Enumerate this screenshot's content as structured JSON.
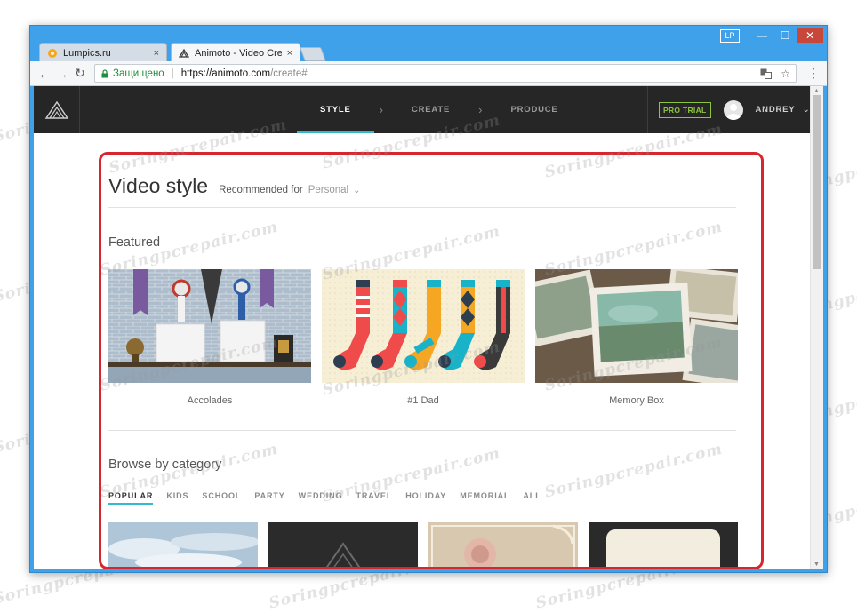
{
  "window": {
    "profile_badge": "LP",
    "minimize": "—",
    "maximize": "☐",
    "close": "✕"
  },
  "tabs": [
    {
      "title": "Lumpics.ru",
      "close": "×"
    },
    {
      "title": "Animoto - Video Creator",
      "close": "×"
    }
  ],
  "toolbar": {
    "back": "←",
    "forward": "→",
    "reload": "↻",
    "secure_label": "Защищено",
    "separator": "|",
    "url_host": "https://animoto.com",
    "url_path": "/create#",
    "star": "☆",
    "menu": "⋮"
  },
  "appbar": {
    "steps": [
      {
        "label": "STYLE",
        "active": true
      },
      {
        "label": "CREATE",
        "active": false
      },
      {
        "label": "PRODUCE",
        "active": false
      }
    ],
    "step_arrow": "›",
    "pro_trial": "PRO TRIAL",
    "user_name": "ANDREY",
    "user_chevron": "⌄"
  },
  "page": {
    "title": "Video style",
    "recommended_label": "Recommended for",
    "recommended_value": "Personal",
    "recommended_chevron": "⌄",
    "featured_heading": "Featured",
    "featured": [
      {
        "label": "Accolades"
      },
      {
        "label": "#1 Dad"
      },
      {
        "label": "Memory Box"
      }
    ],
    "browse_heading": "Browse by category",
    "categories": [
      "POPULAR",
      "KIDS",
      "SCHOOL",
      "PARTY",
      "WEDDING",
      "TRAVEL",
      "HOLIDAY",
      "MEMORIAL",
      "ALL"
    ]
  },
  "scrollbar": {
    "up": "▲",
    "down": "▼"
  },
  "watermark": "Soringpcrepair.com",
  "colors": {
    "accent": "#35b7cf",
    "pro_trial": "#8cc63e",
    "highlight": "#d6262e",
    "appbar_bg": "#262626"
  }
}
